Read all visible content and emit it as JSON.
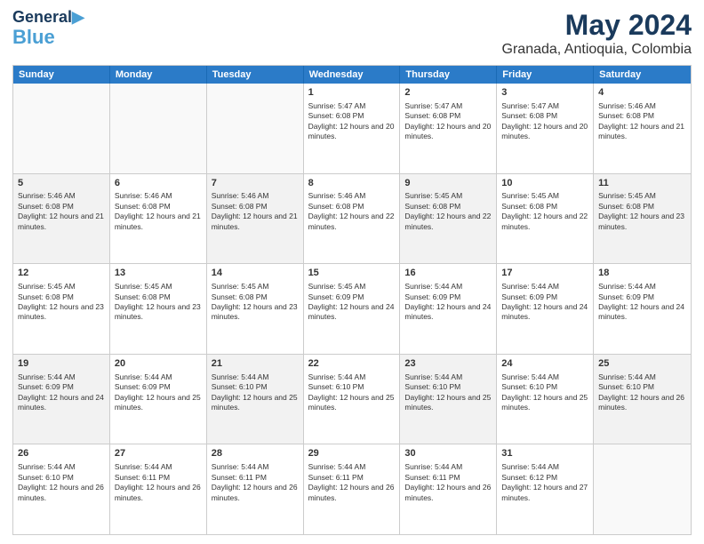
{
  "header": {
    "logo_line1": "General",
    "logo_line2": "Blue",
    "title": "May 2024",
    "subtitle": "Granada, Antioquia, Colombia"
  },
  "days_of_week": [
    "Sunday",
    "Monday",
    "Tuesday",
    "Wednesday",
    "Thursday",
    "Friday",
    "Saturday"
  ],
  "weeks": [
    [
      {
        "day": "",
        "empty": true
      },
      {
        "day": "",
        "empty": true
      },
      {
        "day": "",
        "empty": true
      },
      {
        "day": "1",
        "sunrise": "5:47 AM",
        "sunset": "6:08 PM",
        "daylight": "12 hours and 20 minutes."
      },
      {
        "day": "2",
        "sunrise": "5:47 AM",
        "sunset": "6:08 PM",
        "daylight": "12 hours and 20 minutes."
      },
      {
        "day": "3",
        "sunrise": "5:47 AM",
        "sunset": "6:08 PM",
        "daylight": "12 hours and 20 minutes."
      },
      {
        "day": "4",
        "sunrise": "5:46 AM",
        "sunset": "6:08 PM",
        "daylight": "12 hours and 21 minutes."
      }
    ],
    [
      {
        "day": "5",
        "sunrise": "5:46 AM",
        "sunset": "6:08 PM",
        "daylight": "12 hours and 21 minutes."
      },
      {
        "day": "6",
        "sunrise": "5:46 AM",
        "sunset": "6:08 PM",
        "daylight": "12 hours and 21 minutes."
      },
      {
        "day": "7",
        "sunrise": "5:46 AM",
        "sunset": "6:08 PM",
        "daylight": "12 hours and 21 minutes."
      },
      {
        "day": "8",
        "sunrise": "5:46 AM",
        "sunset": "6:08 PM",
        "daylight": "12 hours and 22 minutes."
      },
      {
        "day": "9",
        "sunrise": "5:45 AM",
        "sunset": "6:08 PM",
        "daylight": "12 hours and 22 minutes."
      },
      {
        "day": "10",
        "sunrise": "5:45 AM",
        "sunset": "6:08 PM",
        "daylight": "12 hours and 22 minutes."
      },
      {
        "day": "11",
        "sunrise": "5:45 AM",
        "sunset": "6:08 PM",
        "daylight": "12 hours and 23 minutes."
      }
    ],
    [
      {
        "day": "12",
        "sunrise": "5:45 AM",
        "sunset": "6:08 PM",
        "daylight": "12 hours and 23 minutes."
      },
      {
        "day": "13",
        "sunrise": "5:45 AM",
        "sunset": "6:08 PM",
        "daylight": "12 hours and 23 minutes."
      },
      {
        "day": "14",
        "sunrise": "5:45 AM",
        "sunset": "6:08 PM",
        "daylight": "12 hours and 23 minutes."
      },
      {
        "day": "15",
        "sunrise": "5:45 AM",
        "sunset": "6:09 PM",
        "daylight": "12 hours and 24 minutes."
      },
      {
        "day": "16",
        "sunrise": "5:44 AM",
        "sunset": "6:09 PM",
        "daylight": "12 hours and 24 minutes."
      },
      {
        "day": "17",
        "sunrise": "5:44 AM",
        "sunset": "6:09 PM",
        "daylight": "12 hours and 24 minutes."
      },
      {
        "day": "18",
        "sunrise": "5:44 AM",
        "sunset": "6:09 PM",
        "daylight": "12 hours and 24 minutes."
      }
    ],
    [
      {
        "day": "19",
        "sunrise": "5:44 AM",
        "sunset": "6:09 PM",
        "daylight": "12 hours and 24 minutes."
      },
      {
        "day": "20",
        "sunrise": "5:44 AM",
        "sunset": "6:09 PM",
        "daylight": "12 hours and 25 minutes."
      },
      {
        "day": "21",
        "sunrise": "5:44 AM",
        "sunset": "6:10 PM",
        "daylight": "12 hours and 25 minutes."
      },
      {
        "day": "22",
        "sunrise": "5:44 AM",
        "sunset": "6:10 PM",
        "daylight": "12 hours and 25 minutes."
      },
      {
        "day": "23",
        "sunrise": "5:44 AM",
        "sunset": "6:10 PM",
        "daylight": "12 hours and 25 minutes."
      },
      {
        "day": "24",
        "sunrise": "5:44 AM",
        "sunset": "6:10 PM",
        "daylight": "12 hours and 25 minutes."
      },
      {
        "day": "25",
        "sunrise": "5:44 AM",
        "sunset": "6:10 PM",
        "daylight": "12 hours and 26 minutes."
      }
    ],
    [
      {
        "day": "26",
        "sunrise": "5:44 AM",
        "sunset": "6:10 PM",
        "daylight": "12 hours and 26 minutes."
      },
      {
        "day": "27",
        "sunrise": "5:44 AM",
        "sunset": "6:11 PM",
        "daylight": "12 hours and 26 minutes."
      },
      {
        "day": "28",
        "sunrise": "5:44 AM",
        "sunset": "6:11 PM",
        "daylight": "12 hours and 26 minutes."
      },
      {
        "day": "29",
        "sunrise": "5:44 AM",
        "sunset": "6:11 PM",
        "daylight": "12 hours and 26 minutes."
      },
      {
        "day": "30",
        "sunrise": "5:44 AM",
        "sunset": "6:11 PM",
        "daylight": "12 hours and 26 minutes."
      },
      {
        "day": "31",
        "sunrise": "5:44 AM",
        "sunset": "6:12 PM",
        "daylight": "12 hours and 27 minutes."
      },
      {
        "day": "",
        "empty": true
      }
    ]
  ],
  "labels": {
    "sunrise_prefix": "Sunrise: ",
    "sunset_prefix": "Sunset: ",
    "daylight_prefix": "Daylight: "
  }
}
